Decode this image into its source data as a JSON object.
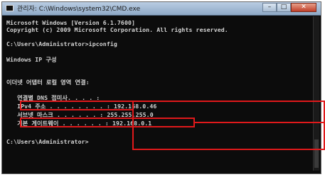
{
  "window": {
    "title": "관리자: C:\\Windows\\system32\\CMD.exe",
    "buttons": {
      "minimize": "–",
      "maximize": "□",
      "close": "✕"
    }
  },
  "console": {
    "lines": [
      "Microsoft Windows [Version 6.1.7600]",
      "Copyright (c) 2009 Microsoft Corporation. All rights reserved.",
      "",
      "C:\\Users\\Administrator>ipconfig",
      "",
      "Windows IP 구성",
      "",
      "",
      "이더넷 어댑터 로컬 영역 연결:",
      "",
      "   연결별 DNS 접미사. . . . :",
      "   IPv4 주소 . . . . . . . . : 192.168.0.46",
      "   서브넷 마스크 . . . . . . : 255.255.255.0",
      "   기본 게이트웨이 . . . . . . : 192.168.0.1",
      "",
      "C:\\Users\\Administrator>"
    ]
  },
  "highlight_color": "#e0191b"
}
